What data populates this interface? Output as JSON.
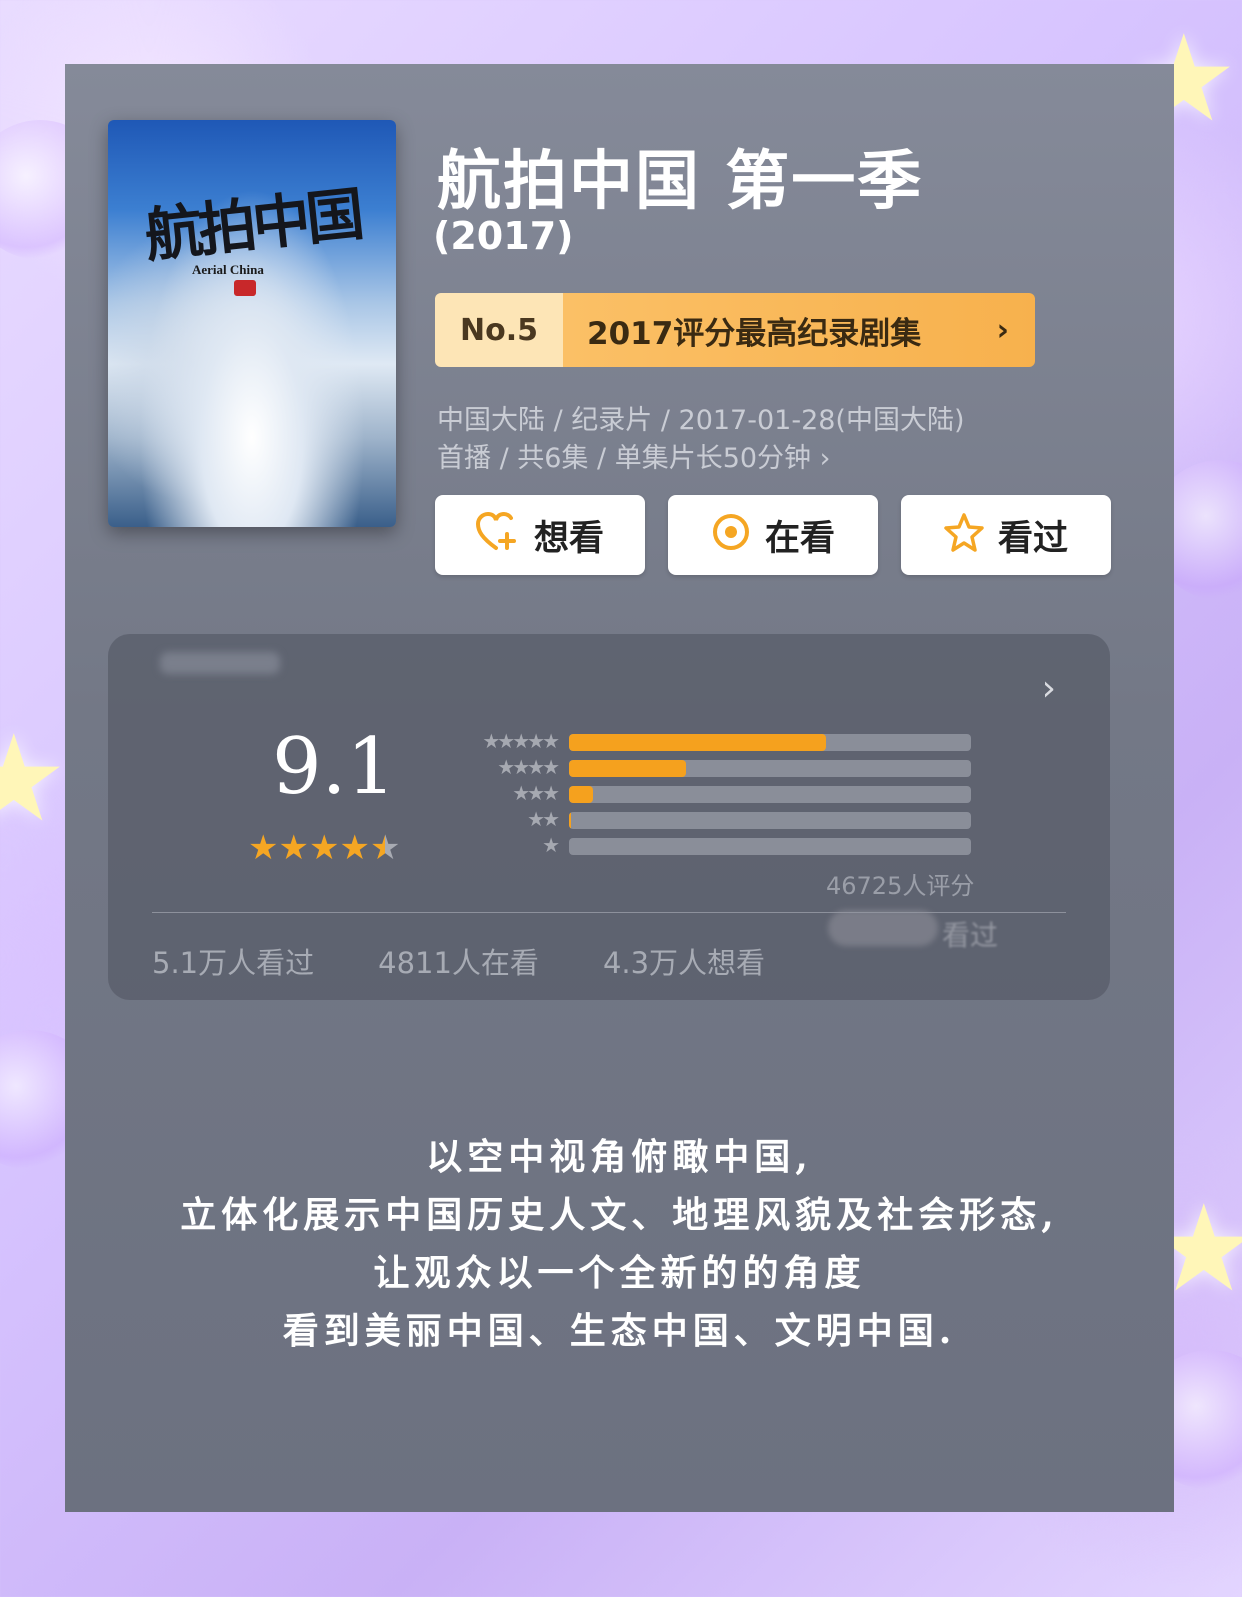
{
  "movie": {
    "title": "航拍中国 第一季",
    "year": "(2017)",
    "poster": {
      "title_cn": "航拍中国",
      "title_en": "Aerial China"
    },
    "rank": {
      "number": "No.5",
      "label": "2017评分最高纪录剧集",
      "chevron": "›"
    },
    "meta_line1": "中国大陆 / 纪录片 / 2017-01-28(中国大陆)",
    "meta_line2": "首播 / 共6集 / 单集片长50分钟 ›"
  },
  "actions": [
    {
      "label": "想看",
      "icon": "heart-plus-icon"
    },
    {
      "label": "在看",
      "icon": "target-icon"
    },
    {
      "label": "看过",
      "icon": "star-outline-icon"
    }
  ],
  "rating": {
    "score": "9.1",
    "stars_value": 4.5,
    "distribution": [
      {
        "stars": 5,
        "ratio": 0.64
      },
      {
        "stars": 4,
        "ratio": 0.29
      },
      {
        "stars": 3,
        "ratio": 0.06
      },
      {
        "stars": 2,
        "ratio": 0.005
      },
      {
        "stars": 1,
        "ratio": 0.0
      }
    ],
    "count_text": "46725人评分",
    "seen_text": "看过"
  },
  "stats": {
    "watched": "5.1万人看过",
    "watching": "4811人在看",
    "want": "4.3万人想看"
  },
  "description": [
    "以空中视角俯瞰中国,",
    "立体化展示中国历史人文、地理风貌及社会形态,",
    "让观众以一个全新的的角度",
    "看到美丽中国、生态中国、文明中国."
  ],
  "colors": {
    "accent": "#f5a623",
    "bar": "#f5a11e",
    "panel": "#737886"
  }
}
